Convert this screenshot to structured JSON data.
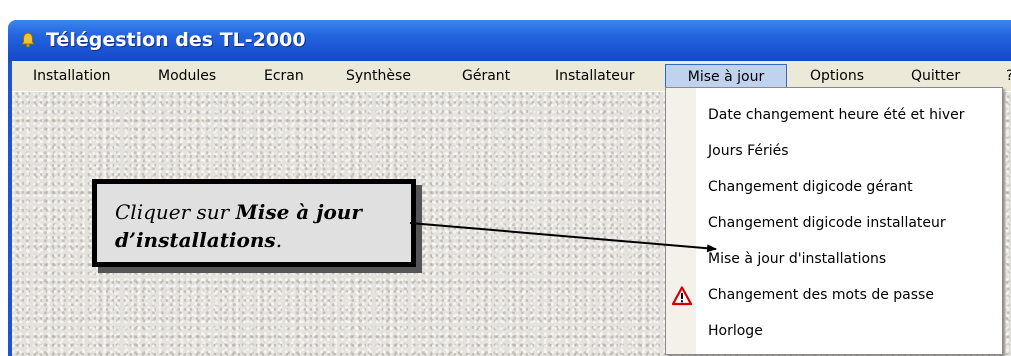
{
  "window": {
    "title": "Télégestion des TL-2000",
    "title_icon": "bell-icon"
  },
  "menubar": {
    "items": [
      {
        "label": "Installation"
      },
      {
        "label": "Modules"
      },
      {
        "label": "Ecran"
      },
      {
        "label": "Synthèse"
      },
      {
        "label": "Gérant"
      },
      {
        "label": "Installateur"
      },
      {
        "label": "Mise à jour",
        "active": true
      },
      {
        "label": "Options"
      },
      {
        "label": "Quitter"
      },
      {
        "label": "?"
      }
    ]
  },
  "dropdown": {
    "items": [
      {
        "label": "Date changement heure été et hiver"
      },
      {
        "label": "Jours Fériés"
      },
      {
        "label": "Changement digicode gérant"
      },
      {
        "label": "Changement digicode installateur"
      },
      {
        "label": "Mise à jour d'installations"
      },
      {
        "label": "Changement des mots de passe",
        "icon": "warning-icon"
      },
      {
        "label": "Horloge"
      }
    ]
  },
  "callout": {
    "prefix": "Cliquer sur ",
    "bold": "Mise à jour d’installations",
    "suffix": "."
  },
  "colors": {
    "titlebar": "#1b55d4",
    "menubar": "#ece9d8",
    "active_menu": "#c1d2ee",
    "warning": "#d40000"
  }
}
